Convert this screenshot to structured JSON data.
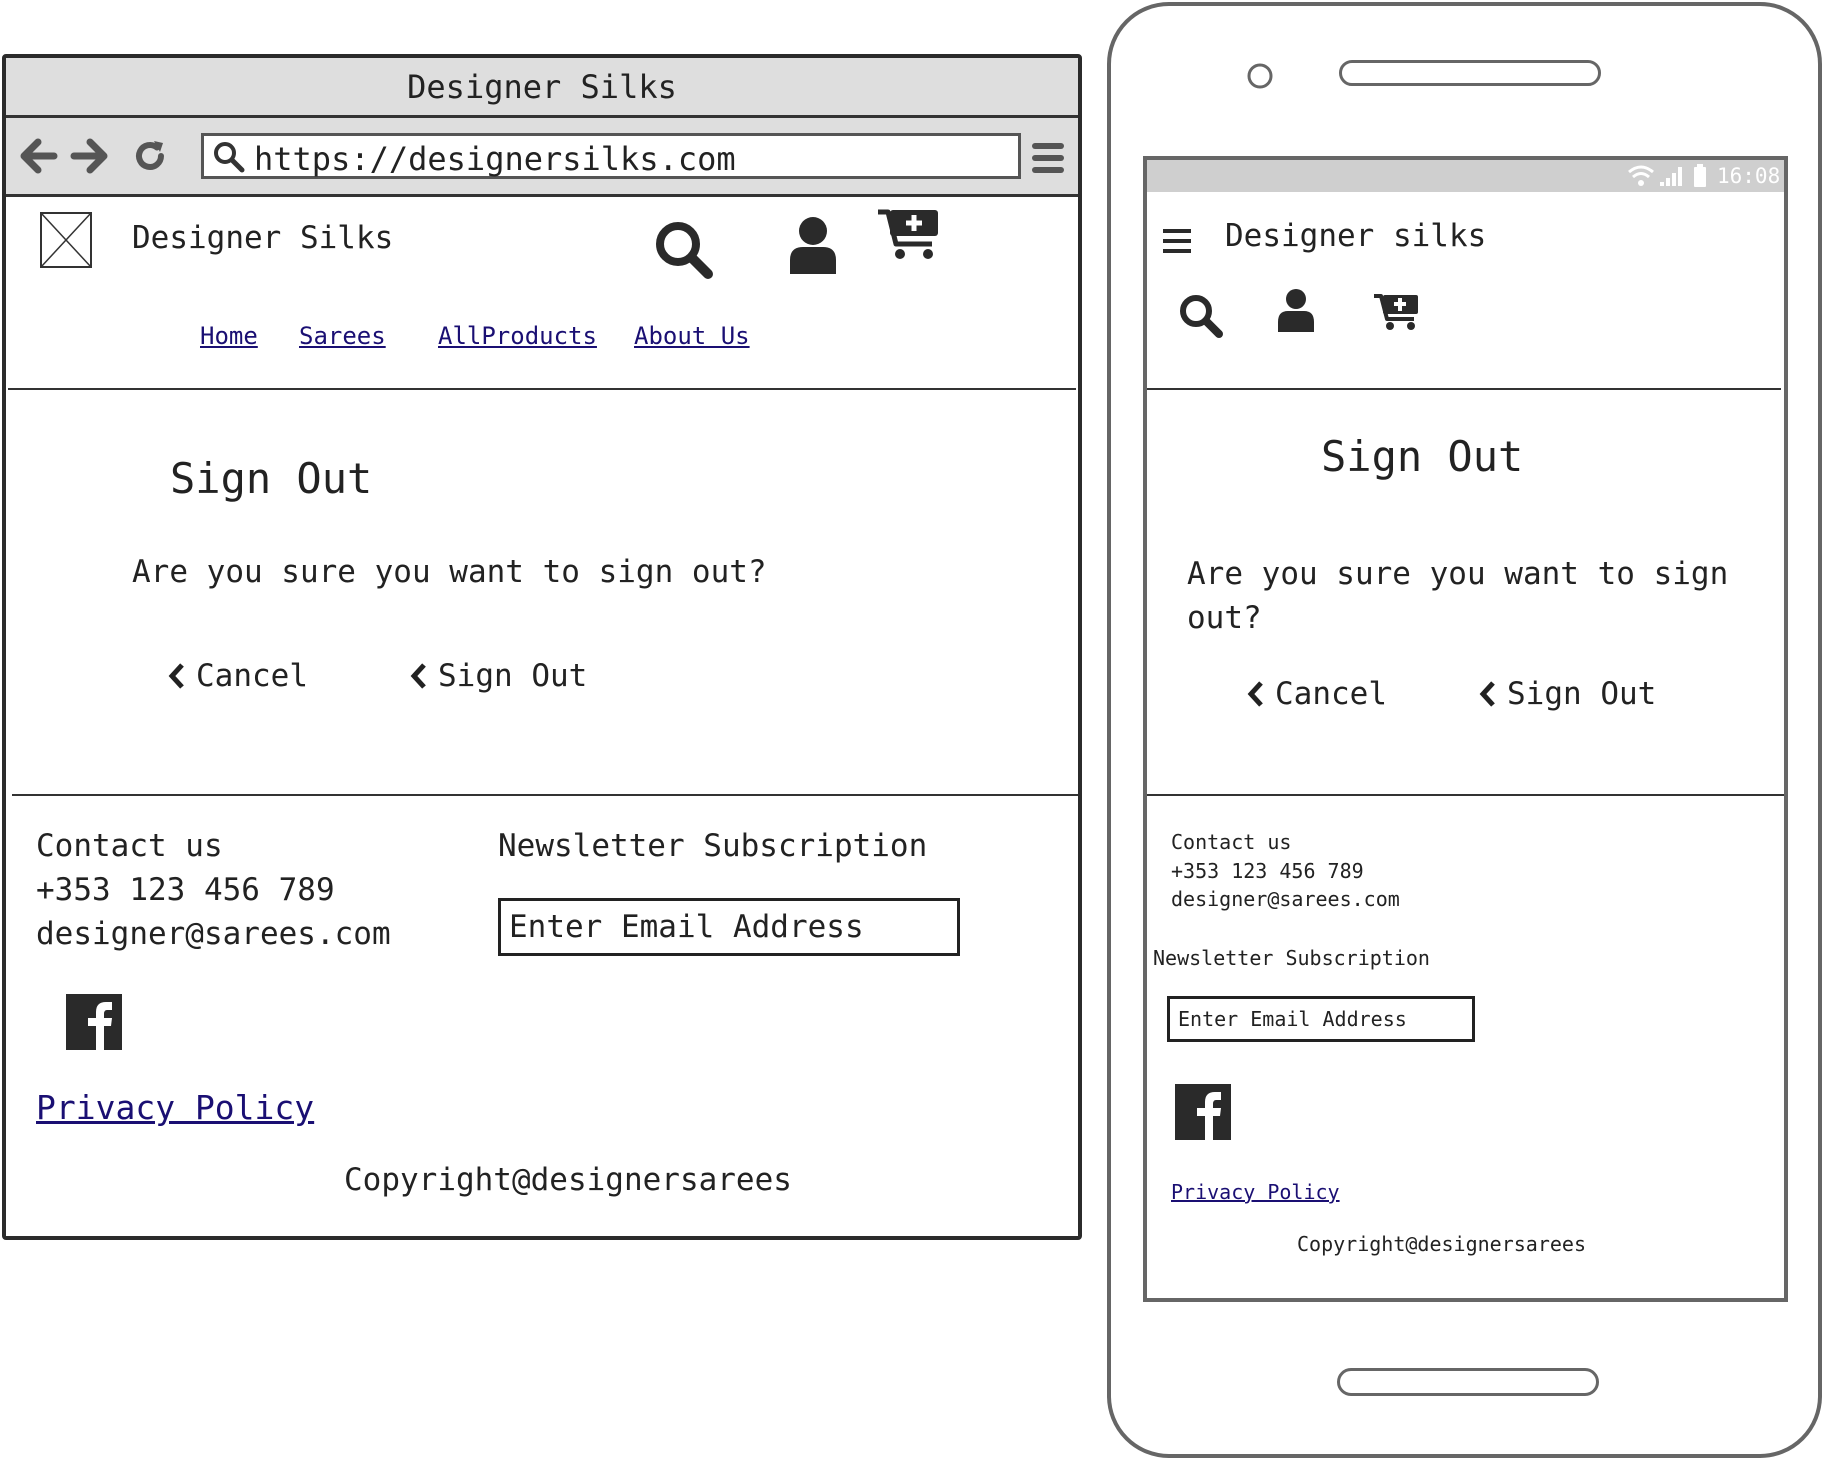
{
  "desktop": {
    "window_title": "Designer Silks",
    "url": "https://designersilks.com",
    "site_name": "Designer Silks",
    "nav": [
      {
        "label": "Home"
      },
      {
        "label": "Sarees"
      },
      {
        "label": "AllProducts"
      },
      {
        "label": "About Us"
      }
    ],
    "heading": "Sign Out",
    "question": "Are you sure you want to sign out?",
    "cancel_label": "Cancel",
    "signout_label": "Sign Out",
    "footer": {
      "contact_title": "Contact us",
      "phone": "+353 123 456 789",
      "email": "designer@sarees.com",
      "newsletter_title": "Newsletter Subscription",
      "email_placeholder": "Enter Email Address",
      "privacy_label": "Privacy Policy",
      "copyright": "Copyright@designersarees"
    }
  },
  "mobile": {
    "status_time": "16:08",
    "site_name": "Designer silks",
    "heading": "Sign Out",
    "question_line1": "Are you sure you want to sign",
    "question_line2": "out?",
    "cancel_label": "Cancel",
    "signout_label": "Sign Out",
    "footer": {
      "contact_title": "Contact us",
      "phone": "+353 123 456 789",
      "email": "designer@sarees.com",
      "newsletter_title": "Newsletter Subscription",
      "email_placeholder": "Enter Email Address",
      "privacy_label": "Privacy Policy",
      "copyright": "Copyright@designersarees"
    }
  },
  "icons": [
    "arrow-left-icon",
    "arrow-right-icon",
    "refresh-icon",
    "search-icon",
    "hamburger-menu-icon",
    "image-placeholder-icon",
    "user-icon",
    "cart-add-icon",
    "facebook-icon",
    "chevron-left-icon",
    "wifi-icon",
    "signal-icon",
    "battery-icon"
  ],
  "colors": {
    "link": "#1a0f73",
    "chrome": "#dedede",
    "frame": "#2b2b2b",
    "phone_frame": "#666666"
  }
}
